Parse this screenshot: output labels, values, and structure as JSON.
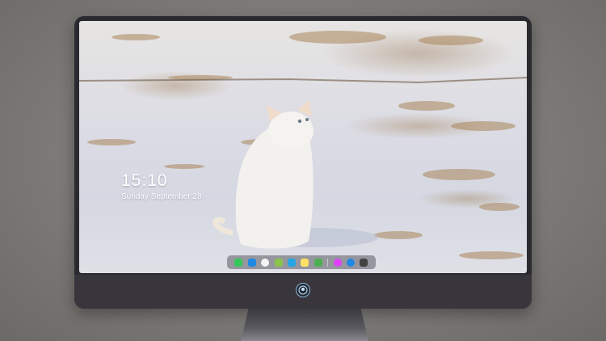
{
  "lock_screen": {
    "time": "15:10",
    "date": "Sunday September 28",
    "note": ""
  },
  "wallpaper": {
    "subject": "cat-in-snow"
  },
  "dock": {
    "apps": [
      {
        "name": "messages-icon",
        "color": "#34c759"
      },
      {
        "name": "mail-icon",
        "color": "#1e88e5"
      },
      {
        "name": "clock-icon",
        "color": "#f5f5f5"
      },
      {
        "name": "maps-icon",
        "color": "#8bc34a"
      },
      {
        "name": "clapper-icon",
        "color": "#26a5e4"
      },
      {
        "name": "notes-icon",
        "color": "#ffe066"
      },
      {
        "name": "photos-icon",
        "color": "#4caf50"
      },
      {
        "name": "music-icon",
        "color": "#e040fb"
      },
      {
        "name": "app-store-icon",
        "color": "#1e88e5"
      },
      {
        "name": "camera-icon",
        "color": "#424242"
      }
    ]
  }
}
